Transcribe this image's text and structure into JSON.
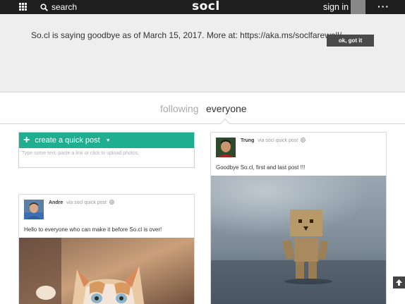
{
  "topbar": {
    "search_label": "search",
    "logo": "socl",
    "signin_label": "sign in"
  },
  "banner": {
    "message": "So.cl is saying goodbye as of March 15, 2017. More at: https://aka.ms/soclfarewell/",
    "button_label": "ok, got it"
  },
  "tabs": {
    "following": "following",
    "everyone": "everyone"
  },
  "quick_post": {
    "title": "create a quick post",
    "placeholder": "Type some text, paste a link or click to upload photos."
  },
  "posts": [
    {
      "author": "Andre",
      "via": "via socl quick post",
      "text": "Hello to everyone who can make it before So.cl is over!"
    },
    {
      "author": "Trung",
      "via": "via socl quick post",
      "text": "Goodbye So.cl, first and last post !!!"
    }
  ],
  "colors": {
    "topbar": "#1e1e1e",
    "accent": "#1fae90",
    "banner_bg": "#eeeeee",
    "button_bg": "#4a4a4a"
  },
  "icons": {
    "apps": "grid-icon",
    "search": "search-icon",
    "more": "ellipsis-icon",
    "visibility": "globe-icon",
    "scroll": "arrow-up-icon"
  }
}
